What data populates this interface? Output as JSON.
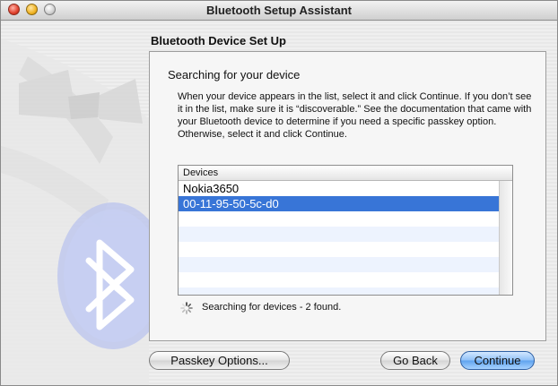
{
  "window": {
    "title": "Bluetooth Setup Assistant"
  },
  "section_title": "Bluetooth Device Set Up",
  "heading": "Searching for your device",
  "instructions": "When your device appears in the list, select it and click Continue. If you don’t see it in the list, make sure it is “discoverable.” See the documentation that came with your Bluetooth device to determine if you need a specific passkey option. Otherwise, select it and click Continue.",
  "devices": {
    "header": "Devices",
    "items": [
      {
        "label": "Nokia3650",
        "selected": false
      },
      {
        "label": "00-11-95-50-5c-d0",
        "selected": true
      }
    ]
  },
  "status": "Searching for devices - 2 found.",
  "buttons": {
    "passkey": "Passkey Options...",
    "back": "Go Back",
    "continue": "Continue"
  },
  "icons": [
    "close-icon",
    "minimize-icon",
    "zoom-icon",
    "spinner-icon",
    "bluetooth-logo-icon"
  ],
  "colors": {
    "selection": "#3875d7",
    "default_button": "#5ea2ee"
  }
}
